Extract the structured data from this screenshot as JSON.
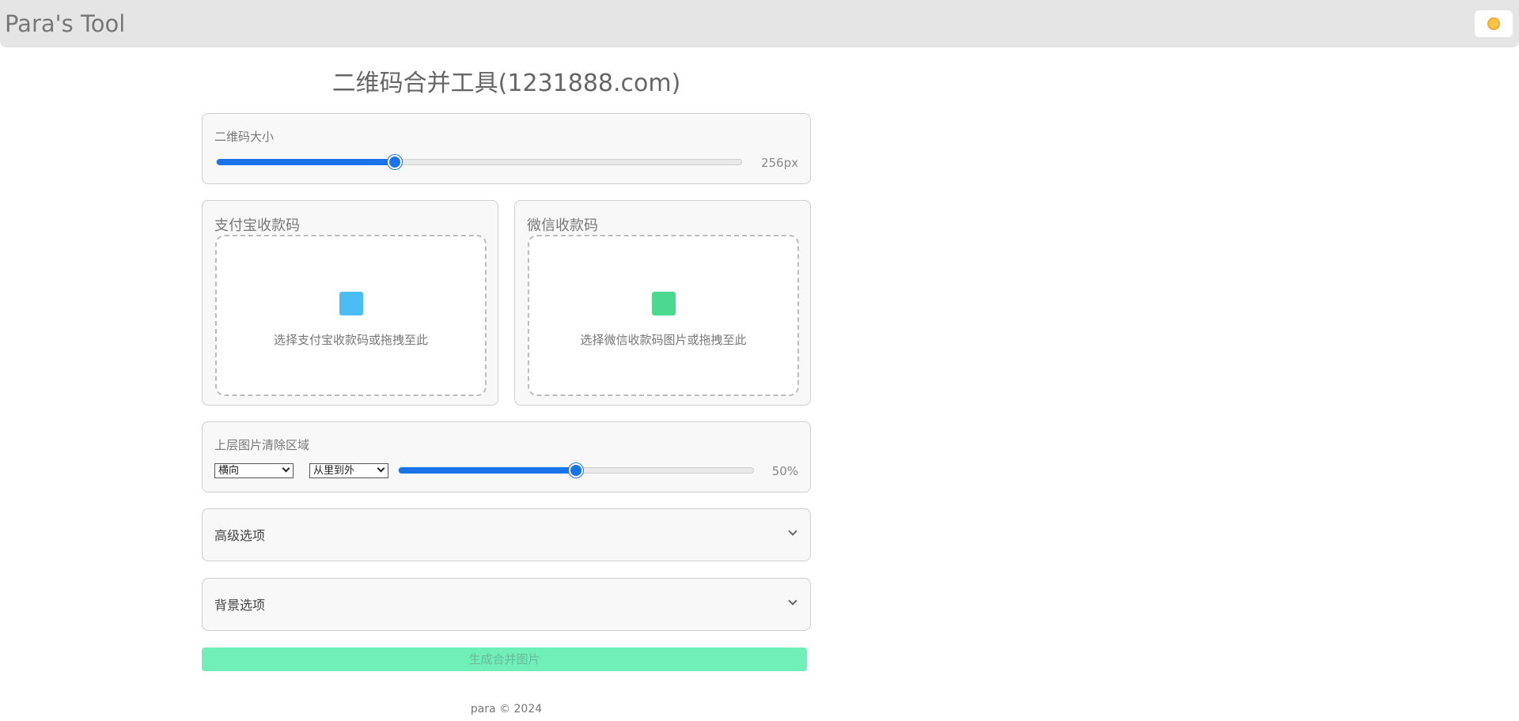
{
  "app": {
    "brand": "Para's Tool",
    "theme_toggle_icon": "sun-icon"
  },
  "page": {
    "title": "二维码合并工具(1231888.com)"
  },
  "size_section": {
    "label": "二维码大小",
    "value_text": "256px",
    "value_fraction": 0.34
  },
  "alipay": {
    "title": "支付宝收款码",
    "drop_text": "选择支付宝收款码或拖拽至此",
    "icon": "alipay-qr-icon",
    "icon_color": "#4bbcf4"
  },
  "wechat": {
    "title": "微信收款码",
    "drop_text": "选择微信收款码图片或拖拽至此",
    "icon": "wechat-qr-icon",
    "icon_color": "#4cd98f"
  },
  "clear_section": {
    "label": "上层图片清除区域",
    "direction_select": "横向",
    "order_select": "从里到外",
    "value_text": "50%",
    "value_fraction": 0.5
  },
  "advanced": {
    "label": "高级选项"
  },
  "background": {
    "label": "背景选项"
  },
  "generate_button": "生成合并图片",
  "footer": "para © 2024",
  "colors": {
    "accent": "#1a73e8",
    "generate_bg": "#70f0b8",
    "topbar_bg": "#e5e5e5"
  }
}
